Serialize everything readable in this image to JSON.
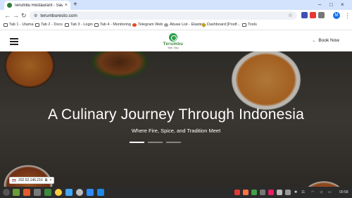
{
  "browser": {
    "tab_title": "Terumbu Restaurant - Savo",
    "tab_close": "×",
    "new_tab": "+",
    "url": "terumburesto.com",
    "window_controls": [
      "–",
      "□",
      "×"
    ],
    "profile_initial": "M"
  },
  "bookmarks": [
    {
      "label": "Tab 1 - Utama",
      "icon": "folder-icon"
    },
    {
      "label": "Tab 2 - Docs",
      "icon": "folder-icon"
    },
    {
      "label": "Tab 3 - Login",
      "icon": "folder-icon"
    },
    {
      "label": "Tab 4 - Monitoring",
      "icon": "folder-icon"
    },
    {
      "label": "Telegram Web",
      "icon": "telegram-icon"
    },
    {
      "label": "Abuse List - Elastic",
      "icon": "globe-icon"
    },
    {
      "label": "Dashboard [Postf...",
      "icon": "dashboard-icon"
    },
    {
      "label": "Tools",
      "icon": "folder-icon"
    }
  ],
  "site": {
    "logo_name": "Terumbu",
    "logo_tagline": "Bali • Bay",
    "book_now": "Book Now",
    "book_arrow": "←"
  },
  "hero": {
    "title": "A Culinary Journey Through Indonesia",
    "subtitle": "Where Fire, Spice, and Tradition Meet",
    "slides_total": 3,
    "active_slide": 1
  },
  "status_chip": {
    "ip": "202.52.146.216",
    "close": "×"
  },
  "taskbar": {
    "clock": "00:58",
    "tray_count": "11"
  },
  "colors": {
    "brand_green": "#2e7d32",
    "tabstrip": "#d3e3fd",
    "taskbar": "#2b2b2b"
  }
}
